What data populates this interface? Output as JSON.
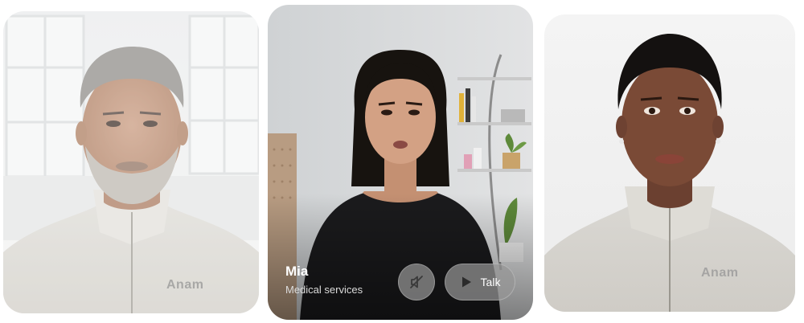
{
  "cards": [
    {
      "id": "left",
      "watermark": "Anam"
    },
    {
      "id": "center",
      "name": "Mia",
      "role": "Medical services",
      "mute_icon": "speaker-muted-icon",
      "talk_icon": "play-icon",
      "talk_label": "Talk"
    },
    {
      "id": "right",
      "watermark": "Anam"
    }
  ]
}
